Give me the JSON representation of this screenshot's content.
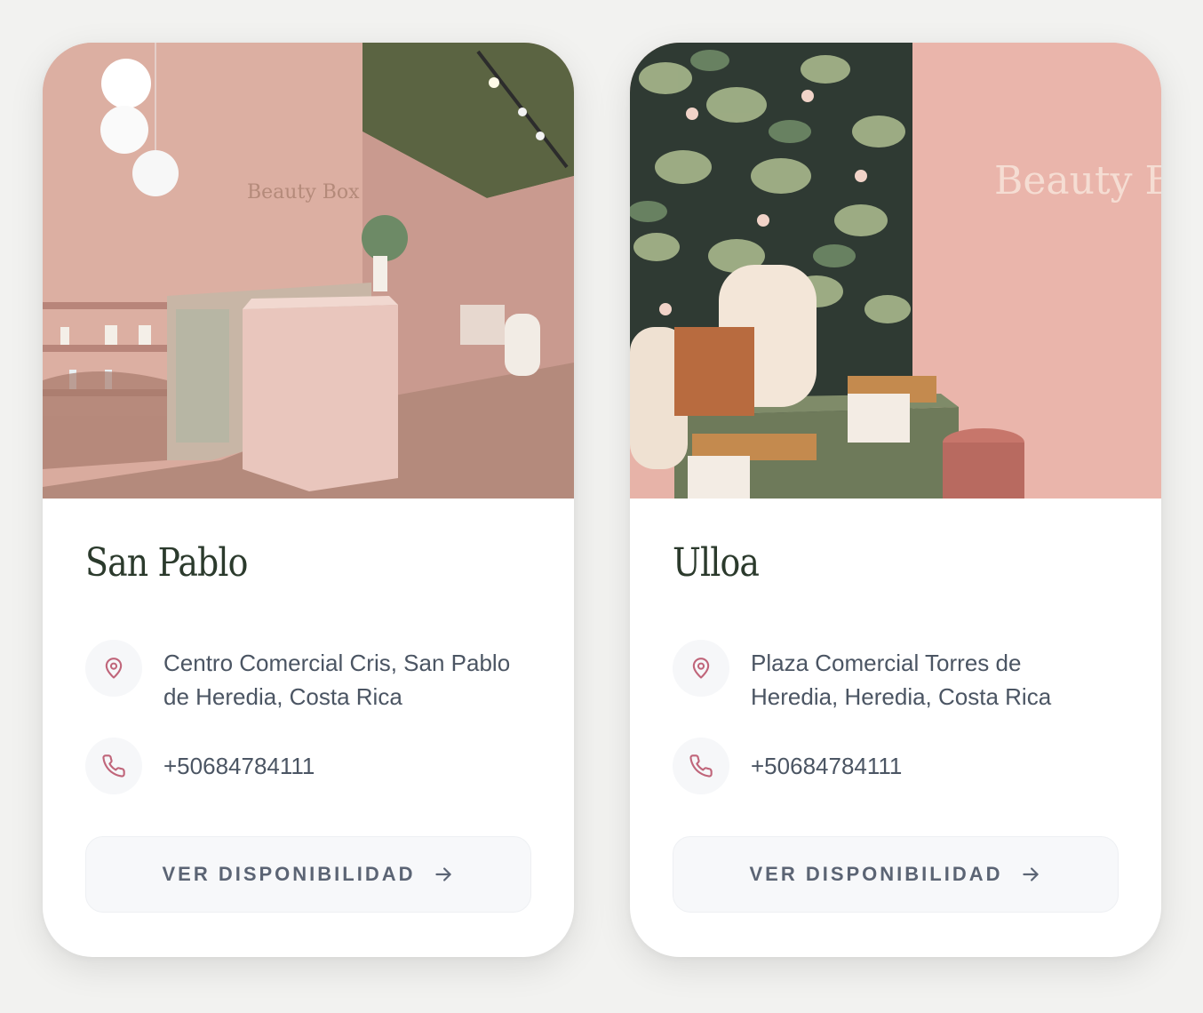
{
  "locations": [
    {
      "name": "San Pablo",
      "address": "Centro Comercial Cris, San Pablo de Heredia, Costa Rica",
      "phone": "+50684784111",
      "button_label": "VER DISPONIBILIDAD",
      "photo_logo_text": "Beauty Box"
    },
    {
      "name": "Ulloa",
      "address": "Plaza Comercial Torres de Heredia, Heredia, Costa Rica",
      "phone": "+50684784111",
      "button_label": "VER DISPONIBILIDAD",
      "photo_logo_text": "Beauty Box"
    }
  ],
  "icons": {
    "address": "map-pin-icon",
    "phone": "phone-icon",
    "button": "arrow-right-icon"
  },
  "colors": {
    "title": "#2b3a2c",
    "icon_accent": "#c0657a",
    "body_text": "#4b5563",
    "button_text": "#5b6474",
    "button_bg": "#f7f8fa"
  }
}
